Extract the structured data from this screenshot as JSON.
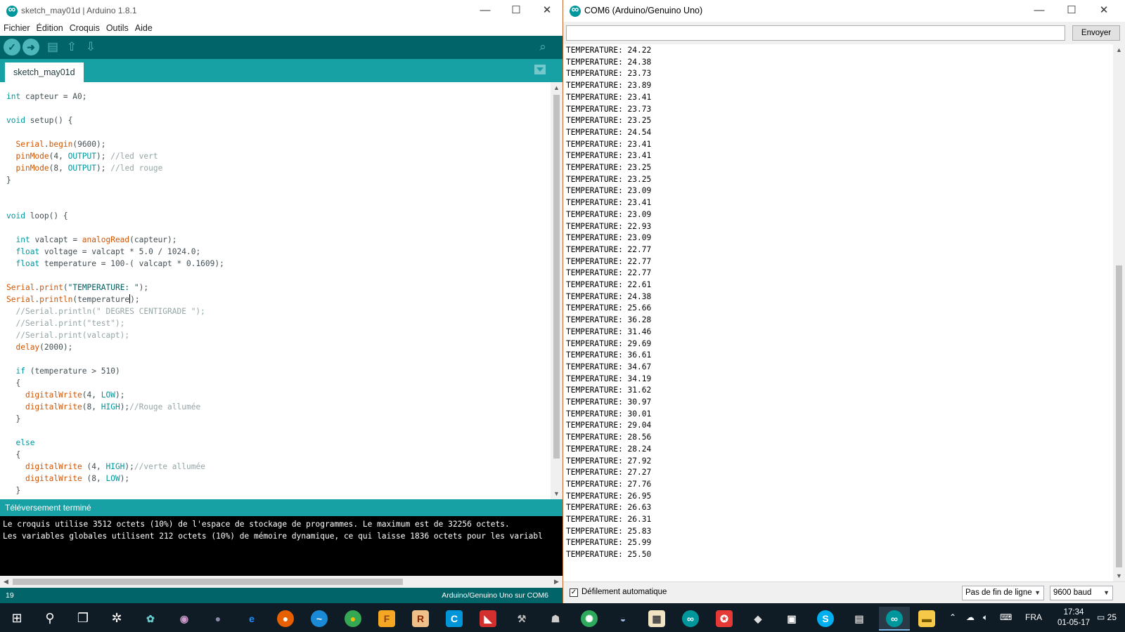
{
  "ide": {
    "title": "sketch_may01d | Arduino 1.8.1",
    "menu": [
      "Fichier",
      "Édition",
      "Croquis",
      "Outils",
      "Aide"
    ],
    "tab": "sketch_may01d",
    "status": "Téléversement terminé",
    "console": [
      "Le croquis utilise 3512 octets (10%) de l'espace de stockage de programmes. Le maximum est de 32256 octets.",
      "Les variables globales utilisent 212 octets (10%) de mémoire dynamique, ce qui laisse 1836 octets pour les variabl"
    ],
    "line_number": "19",
    "board": "Arduino/Genuino Uno sur COM6",
    "code": [
      "int capteur = A0;",
      "",
      "void setup() {",
      "",
      "  Serial.begin(9600);",
      "  pinMode(4, OUTPUT); //led vert",
      "  pinMode(8, OUTPUT); //led rouge",
      "}",
      "",
      "",
      "void loop() {",
      "",
      "  int valcapt = analogRead(capteur);",
      "  float voltage = valcapt * 5.0 / 1024.0;",
      "  float temperature = 100-( valcapt * 0.1609);",
      "",
      "Serial.print(\"TEMPERATURE: \");",
      "Serial.println(temperature);",
      "  //Serial.println(\" DEGRES CENTIGRADE \");",
      "  //Serial.print(\"test\");",
      "  //Serial.print(valcapt);",
      "  delay(2000);",
      "",
      "  if (temperature > 510)",
      "  {",
      "    digitalWrite(4, LOW);",
      "    digitalWrite(8, HIGH);//Rouge allumée",
      "  }",
      "",
      "  else",
      "  {",
      "    digitalWrite (4, HIGH);//verte allumée",
      "    digitalWrite (8, LOW);",
      "  }"
    ]
  },
  "serial": {
    "title": "COM6 (Arduino/Genuino Uno)",
    "send_label": "Envoyer",
    "input_value": "",
    "autoscroll_label": "Défilement automatique",
    "autoscroll_checked": true,
    "line_ending": "Pas de fin de ligne",
    "baud": "9600 baud",
    "prefix": "TEMPERATURE: ",
    "readings": [
      "24.22",
      "24.38",
      "23.73",
      "23.89",
      "23.41",
      "23.73",
      "23.25",
      "24.54",
      "23.41",
      "23.41",
      "23.25",
      "23.25",
      "23.09",
      "23.41",
      "23.09",
      "22.93",
      "23.09",
      "22.77",
      "22.77",
      "22.77",
      "22.61",
      "24.38",
      "25.66",
      "36.28",
      "31.46",
      "29.69",
      "36.61",
      "34.67",
      "34.19",
      "31.62",
      "30.97",
      "30.01",
      "29.04",
      "28.56",
      "28.24",
      "27.92",
      "27.27",
      "27.76",
      "26.95",
      "26.63",
      "26.31",
      "25.83",
      "25.99",
      "25.50"
    ]
  },
  "taskbar": {
    "language": "FRA",
    "time": "17:34",
    "date": "01-05-17",
    "notifications": "25"
  }
}
